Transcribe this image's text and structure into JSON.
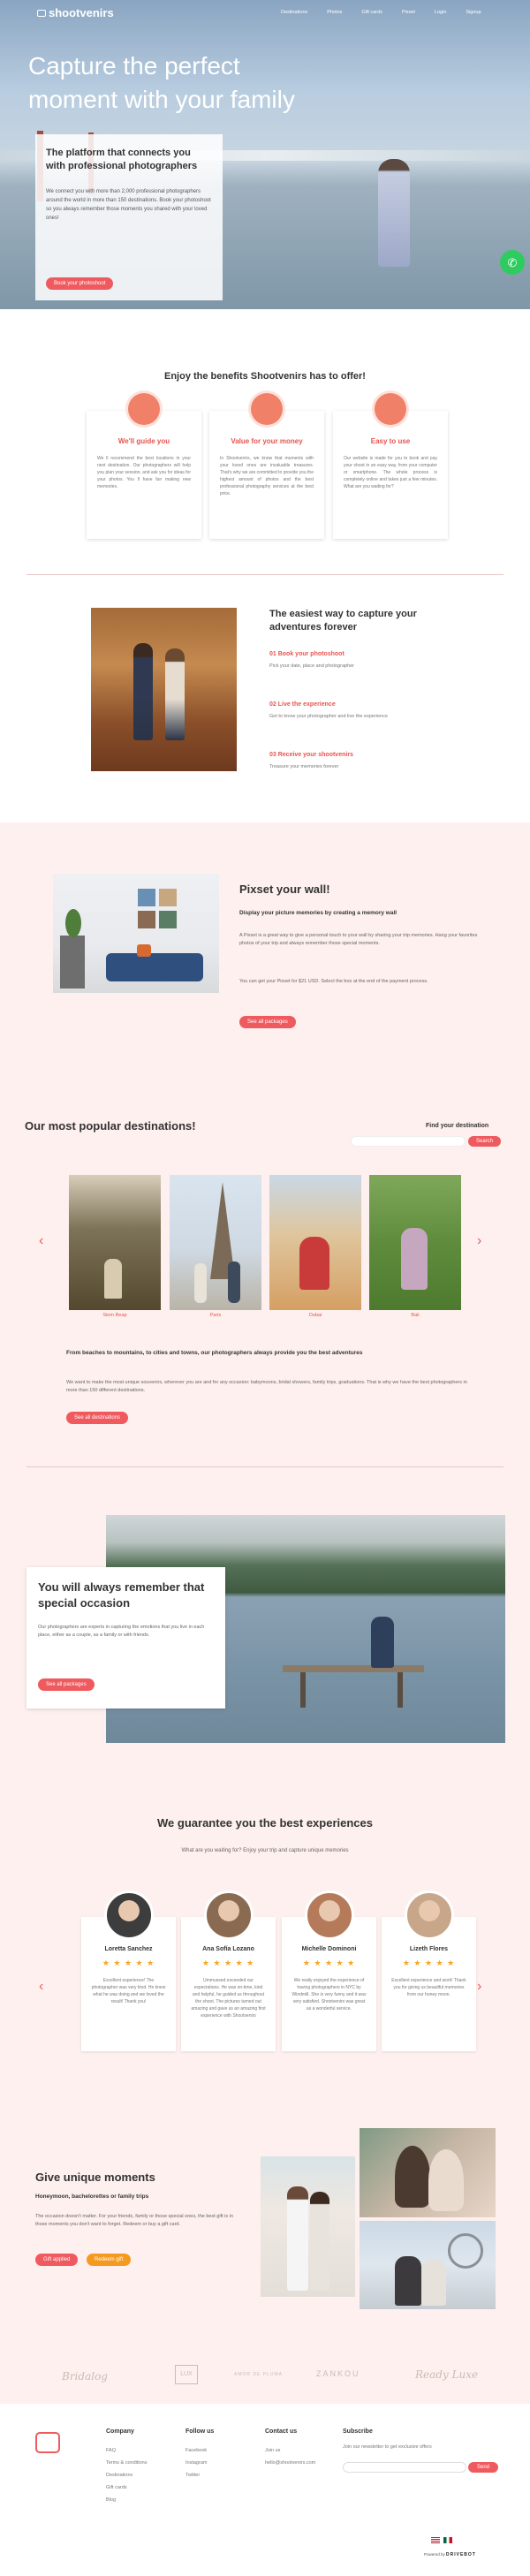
{
  "nav": {
    "logo": "shootvenirs",
    "links": [
      "Destinations",
      "Photos",
      "Gift cards",
      "Pixset",
      "Login",
      "Signup"
    ]
  },
  "hero": {
    "title_line1": "Capture the perfect",
    "title_line2_a": "moment with your ",
    "title_line2_b": "family",
    "card_title": "The platform that connects you with professional photographers",
    "card_text": "We connect you with more than 2,000 professional photographers around the world in more than 150 destinations. Book your photoshoot so you always remember those moments you shared with your loved ones!",
    "cta": "Book your photoshoot"
  },
  "benefits": {
    "title": "Enjoy the benefits Shootvenirs has to offer!",
    "cards": [
      {
        "title": "We'll guide you",
        "text": "We ll recommend the best locations in your next destination. Our photographers will help you plan your session, and ask you for ideas for your photos. You ll have fun making new memories."
      },
      {
        "title": "Value for your money",
        "text": "In Shootvenirs, we know that moments with your loved ones are invaluable treasures. That's why we are committed to provide you the highest amount of photos and the best professional photography services at the best price."
      },
      {
        "title": "Easy to use",
        "text": "Our website is made for you to book and pay your shoot in an easy way, from your computer or smartphone. The whole process is completely online and takes just a few minutes. What are you waiting for?"
      }
    ]
  },
  "steps": {
    "title": "The easiest way to capture your adventures forever",
    "items": [
      {
        "title": "01 Book your photoshoot",
        "text": "Pick your date, place and photographer"
      },
      {
        "title": "02 Live the experience",
        "text": "Get to know your photographer and live the experience"
      },
      {
        "title": "03 Receive your shootvenirs",
        "text": "Treasure your memories forever"
      }
    ]
  },
  "pixset": {
    "title": "Pixset your wall!",
    "subtitle": "Display your picture memories by creating a memory wall",
    "p1": "A Pixset is a great way to give a personal touch to your wall by sharing your trip memories. Hang your favorites photos of your trip and always remember those special moments.",
    "p2": "You can get your Pixset for $21 USD. Select the box at the end of the payment process.",
    "cta": "See all packages"
  },
  "destinations": {
    "title": "Our most popular destinations!",
    "find": "Find your destination",
    "search_btn": "Search",
    "cities": [
      "Siem Reap",
      "Paris",
      "Dubai",
      "Bali"
    ],
    "subtitle": "From beaches to mountains, to cities and towns, our photographers always provide you the best adventures",
    "text": "We want to make the most unique souvenirs, wherever you are and for any occasion: babymoons, bridal showers, family trips, graduations. That is why we have the best photographers in more than 150 different destinations.",
    "cta": "See all destinations"
  },
  "occasion": {
    "title": "You will always remember that special occasion",
    "text": "Our photographers are experts in capturing the emotions that you live in each place, either as a couple, as a family or with friends.",
    "cta": "See all packages"
  },
  "reviews": {
    "title": "We guarantee you the best experiences",
    "subtitle": "What are you waiting for? Enjoy your trip and capture unique memories",
    "stars": "★ ★ ★ ★ ★",
    "items": [
      {
        "name": "Loretta Sanchez",
        "text": "Excellent experience! The photographer was very kind. He knew what he was doing and we loved the result! Thank you!"
      },
      {
        "name": "Ana Sofía Lozano",
        "text": "Ummussed exceeded our expectations. He was on-time, kind and helpful, he guided us throughout the shoot. The pictures turned out amazing and gave us an amazing first experience with Shootvenirs"
      },
      {
        "name": "Michelle Dominoni",
        "text": "We really enjoyed the experience of having photographers in NYC by Windmill. She is very funny and it was very satisfied. Shootvenirs was great as a wonderful service."
      },
      {
        "name": "Lizeth Flores",
        "text": "Excellent experience and work! Thank you for giving us beautiful memories from our honey moon."
      }
    ]
  },
  "gift": {
    "title": "Give unique moments",
    "subtitle": "Honeymoon, bachelorettes or family trips",
    "text": "The occasion doesn't matter. For your friends, family or those special ones, the best gift is in those moments you don't want to forget. Redeem or buy a gift card.",
    "btn1": "Gift applied",
    "btn2": "Redeem gift"
  },
  "partners": [
    "Bridalog",
    "LUX",
    "AMOR DE PLUMA",
    "ZANKOU",
    "Ready Luxe"
  ],
  "footer": {
    "company_title": "Company",
    "company": [
      "FAQ",
      "Terms & conditions",
      "Destinations",
      "Gift cards",
      "Blog"
    ],
    "follow_title": "Follow us",
    "follow": [
      "Facebook",
      "Instagram",
      "Twitter"
    ],
    "contact_title": "Contact us",
    "contact": [
      "Join us",
      "hello@shootvenirs.com"
    ],
    "subscribe_title": "Subscribe",
    "subscribe_text": "Join our newsletter to get exclusive offers",
    "send": "Send",
    "powered": "Powered by",
    "powered_brand": "DRIVEBOT"
  },
  "colors": {
    "accent": "#ef5a5f",
    "pink_bg": "#fdf0ee"
  }
}
